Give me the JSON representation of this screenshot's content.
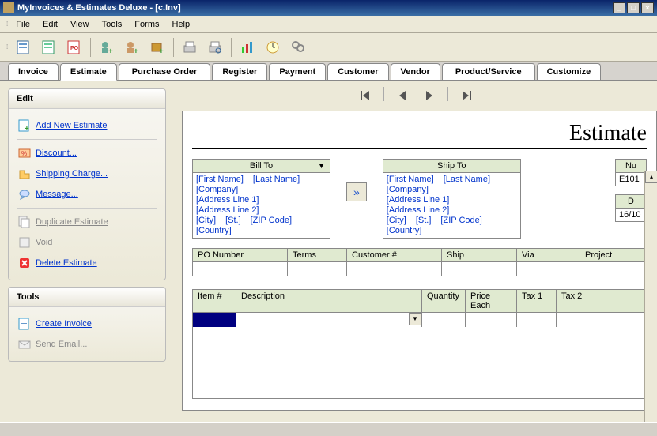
{
  "title": "MyInvoices & Estimates Deluxe - [c.Inv]",
  "menu": {
    "file": "File",
    "edit": "Edit",
    "view": "View",
    "tools": "Tools",
    "forms": "Forms",
    "help": "Help"
  },
  "tabs": [
    "Invoice",
    "Estimate",
    "Purchase Order",
    "Register",
    "Payment",
    "Customer",
    "Vendor",
    "Product/Service",
    "Customize"
  ],
  "active_tab": "Estimate",
  "sidebar": {
    "edit": {
      "title": "Edit",
      "add": "Add New Estimate",
      "discount": "Discount...",
      "shipping": "Shipping Charge...",
      "message": "Message...",
      "duplicate": "Duplicate Estimate",
      "void": "Void",
      "delete": "Delete Estimate"
    },
    "tools": {
      "title": "Tools",
      "create": "Create Invoice",
      "send": "Send Email..."
    }
  },
  "document": {
    "title": "Estimate",
    "bill_to": {
      "label": "Bill To",
      "first": "[First Name]",
      "last": "[Last Name]",
      "company": "[Company]",
      "addr1": "[Address Line 1]",
      "addr2": "[Address Line 2]",
      "city": "[City]",
      "st": "[St.]",
      "zip": "[ZIP Code]",
      "country": "[Country]"
    },
    "ship_to": {
      "label": "Ship To",
      "first": "[First Name]",
      "last": "[Last Name]",
      "company": "[Company]",
      "addr1": "[Address Line 1]",
      "addr2": "[Address Line 2]",
      "city": "[City]",
      "st": "[St.]",
      "zip": "[ZIP Code]",
      "country": "[Country]"
    },
    "number": {
      "label": "Nu",
      "value": "E101"
    },
    "date": {
      "label": "D",
      "value": "16/10"
    },
    "grid1_headers": {
      "po": "PO Number",
      "terms": "Terms",
      "cust": "Customer #",
      "ship": "Ship",
      "via": "Via",
      "project": "Project"
    },
    "items_headers": {
      "item": "Item #",
      "desc": "Description",
      "qty": "Quantity",
      "price": "Price Each",
      "tax1": "Tax 1",
      "tax2": "Tax 2"
    }
  },
  "status": ""
}
